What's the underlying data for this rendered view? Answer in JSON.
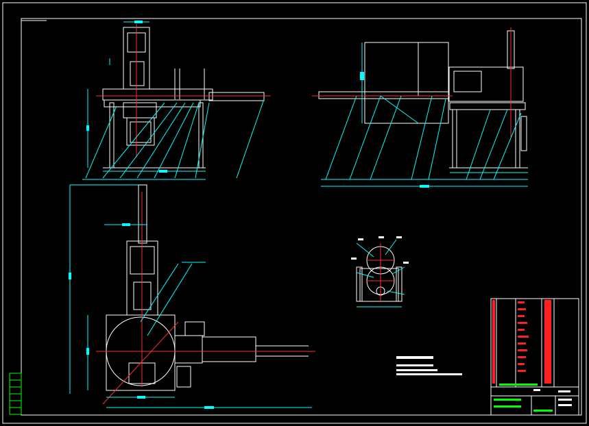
{
  "drawing": {
    "background": "#000000",
    "colors": {
      "outline": "#ffffff",
      "dimension": "#00ffff",
      "centerline": "#ff3030",
      "annotation_green": "#00ff00",
      "title_red": "#ff2020"
    },
    "views": [
      {
        "name": "front-view",
        "label": ""
      },
      {
        "name": "side-view",
        "label": ""
      },
      {
        "name": "top-view",
        "label": ""
      },
      {
        "name": "detail-rollers",
        "label": ""
      }
    ],
    "title_block": {
      "title": ""
    }
  }
}
